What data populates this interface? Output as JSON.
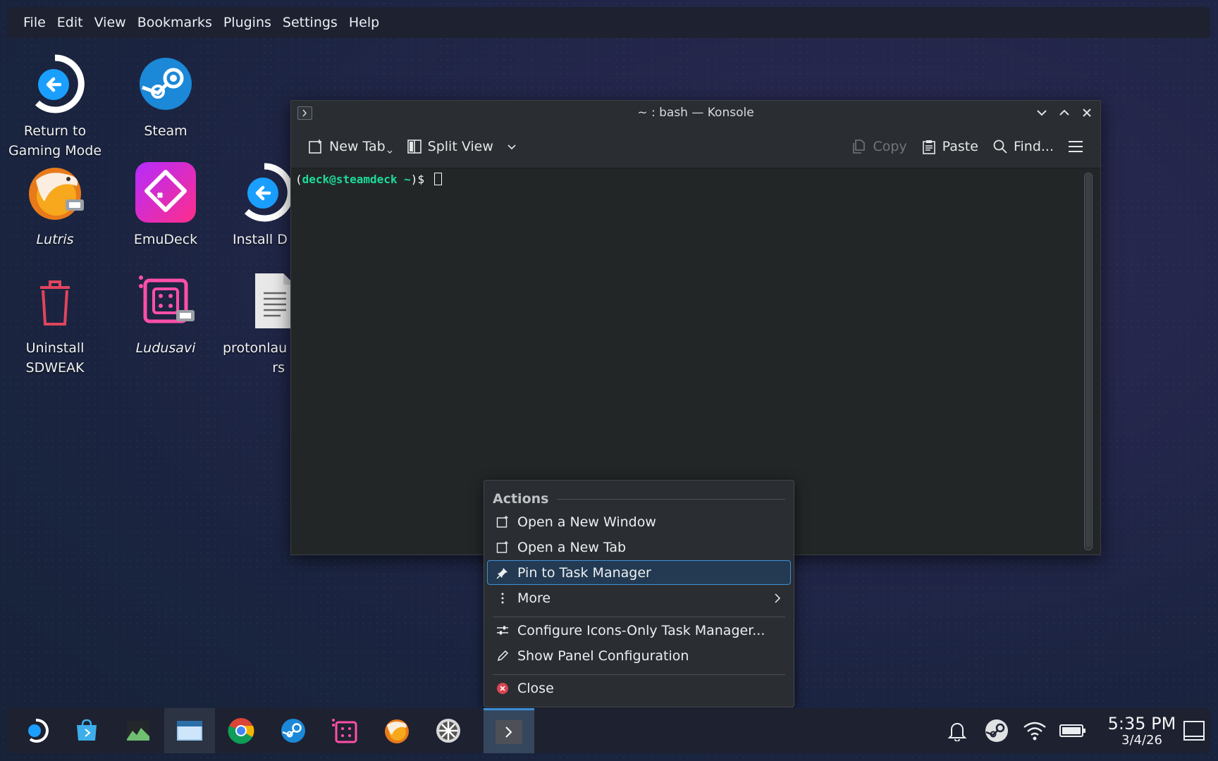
{
  "menubar": [
    "File",
    "Edit",
    "View",
    "Bookmarks",
    "Plugins",
    "Settings",
    "Help"
  ],
  "desktop": {
    "return_to_gaming": "Return to\nGaming Mode",
    "steam": "Steam",
    "lutris": "Lutris",
    "emudeck": "EmuDeck",
    "install_decky": "Install D",
    "uninstall_sdweak": "Uninstall\nSDWEAK",
    "ludusavi": "Ludusavi",
    "protonlaunchers": "protonlau\nrs"
  },
  "konsole": {
    "title": "~ : bash — Konsole",
    "toolbar": {
      "new_tab": "New Tab",
      "split_view": "Split View",
      "copy": "Copy",
      "paste": "Paste",
      "find": "Find..."
    },
    "prompt_user": "deck@steamdeck",
    "prompt_dir": "~",
    "prompt_symbol": ")$"
  },
  "context_menu": {
    "section": "Actions",
    "items": {
      "new_window": "Open a New Window",
      "new_tab": "Open a New Tab",
      "pin": "Pin to Task Manager",
      "more": "More",
      "configure": "Configure Icons-Only Task Manager...",
      "panel_config": "Show Panel Configuration",
      "close": "Close"
    }
  },
  "taskbar": {
    "time": "5:35 PM",
    "date": "3/4/26"
  },
  "colors": {
    "accent": "#3d8fd8",
    "prompt_green": "#1cdc9a",
    "close_red": "#da4453"
  }
}
